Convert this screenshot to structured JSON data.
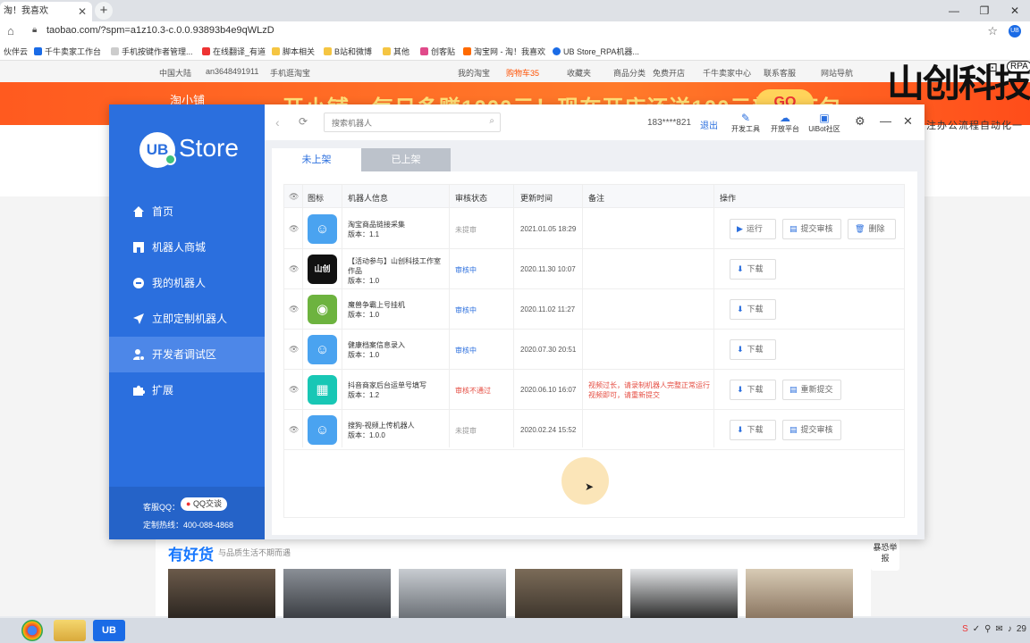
{
  "browser": {
    "tab_title": "淘！我喜欢",
    "url": "taobao.com/?spm=a1z10.3-c.0.0.93893b4e9qWLzD",
    "bookmarks": [
      "伙伴云",
      "千牛卖家工作台",
      "手机按键作者管理...",
      "在线翻译_有道",
      "脚本相关",
      "B站和微博",
      "其他",
      "创客贴",
      "淘宝网 - 淘！我喜欢",
      "UB Store_RPA机器..."
    ]
  },
  "taobao": {
    "nav": [
      "中国大陆",
      "an3648491911",
      "手机逛淘宝",
      "我的淘宝",
      "购物车35",
      "收藏夹",
      "商品分类",
      "免费开店",
      "千牛卖家中心",
      "联系客服",
      "网站导航"
    ],
    "banner_logo": "淘小铺",
    "banner_text": "开小铺，每日多赚1000元！现在开店还送100元新人红包",
    "banner_button": "GO",
    "section_title": "有好货",
    "section_subtitle": "与品质生活不期而遇",
    "side_tab": "暴恐举报"
  },
  "brand_overlay": {
    "name": "山创科技",
    "rpa": "RPA",
    "slogan": "专注办公流程自动化一"
  },
  "ubstore": {
    "logo": "UB",
    "logo_text": "Store",
    "menu": [
      {
        "label": "首页",
        "icon": "home-icon"
      },
      {
        "label": "机器人商城",
        "icon": "store-icon"
      },
      {
        "label": "我的机器人",
        "icon": "robot-icon"
      },
      {
        "label": "立即定制机器人",
        "icon": "send-icon"
      },
      {
        "label": "开发者调试区",
        "icon": "developer-icon"
      },
      {
        "label": "扩展",
        "icon": "puzzle-icon"
      }
    ],
    "active_menu": "开发者调试区",
    "footer": {
      "service_label": "客服QQ：",
      "qq_button": "QQ交谈",
      "hotline": "定制热线：400-088-4868"
    },
    "search_placeholder": "搜索机器人",
    "user_phone": "183****821",
    "logout": "退出",
    "tools": [
      {
        "label": "开发工具",
        "icon": "pen-icon"
      },
      {
        "label": "开放平台",
        "icon": "cloud-icon"
      },
      {
        "label": "UiBot社区",
        "icon": "chat-icon"
      }
    ],
    "tabs": {
      "unpublished": "未上架",
      "published": "已上架"
    },
    "columns": [
      "图标",
      "机器人信息",
      "审核状态",
      "更新时间",
      "备注",
      "操作"
    ],
    "rows": [
      {
        "name": "淘宝商品链接采集",
        "version": "版本：1.1",
        "status": "未提审",
        "status_color": "#999999",
        "time": "2021.01.05 18:29",
        "note": "",
        "icon_color": "#4aa3f0",
        "icon_text": "☺",
        "actions": [
          "运行",
          "提交审核",
          "删除"
        ]
      },
      {
        "name": "【活动参与】山创科技工作室作品",
        "version": "版本：1.0",
        "status": "审核中",
        "status_color": "#2b6fde",
        "time": "2020.11.30 10:07",
        "note": "",
        "icon_color": "#111111",
        "icon_text": "山创",
        "actions": [
          "下载"
        ]
      },
      {
        "name": "魔兽争霸上号挂机",
        "version": "版本：1.0",
        "status": "审核中",
        "status_color": "#2b6fde",
        "time": "2020.11.02 11:27",
        "note": "",
        "icon_color": "#6db33f",
        "icon_text": "◉",
        "actions": [
          "下载"
        ]
      },
      {
        "name": "健康档案信息录入",
        "version": "版本：1.0",
        "status": "审核中",
        "status_color": "#2b6fde",
        "time": "2020.07.30 20:51",
        "note": "",
        "icon_color": "#4aa3f0",
        "icon_text": "☺",
        "actions": [
          "下载"
        ]
      },
      {
        "name": "抖音商家后台运单号填写",
        "version": "版本：1.2",
        "status": "审核不通过",
        "status_color": "#e54d42",
        "time": "2020.06.10 16:07",
        "note": "视频过长，请录制机器人完整正常运行视频即可，请重新提交",
        "icon_color": "#18c7b5",
        "icon_text": "▦",
        "actions": [
          "下载",
          "重新提交"
        ]
      },
      {
        "name": "搜狗-视频上传机器人",
        "version": "版本：1.0.0",
        "status": "未提审",
        "status_color": "#999999",
        "time": "2020.02.24 15:52",
        "note": "",
        "icon_color": "#4aa3f0",
        "icon_text": "☺",
        "actions": [
          "下载",
          "提交审核"
        ]
      }
    ]
  },
  "taskbar": {
    "tray_text": "29"
  }
}
